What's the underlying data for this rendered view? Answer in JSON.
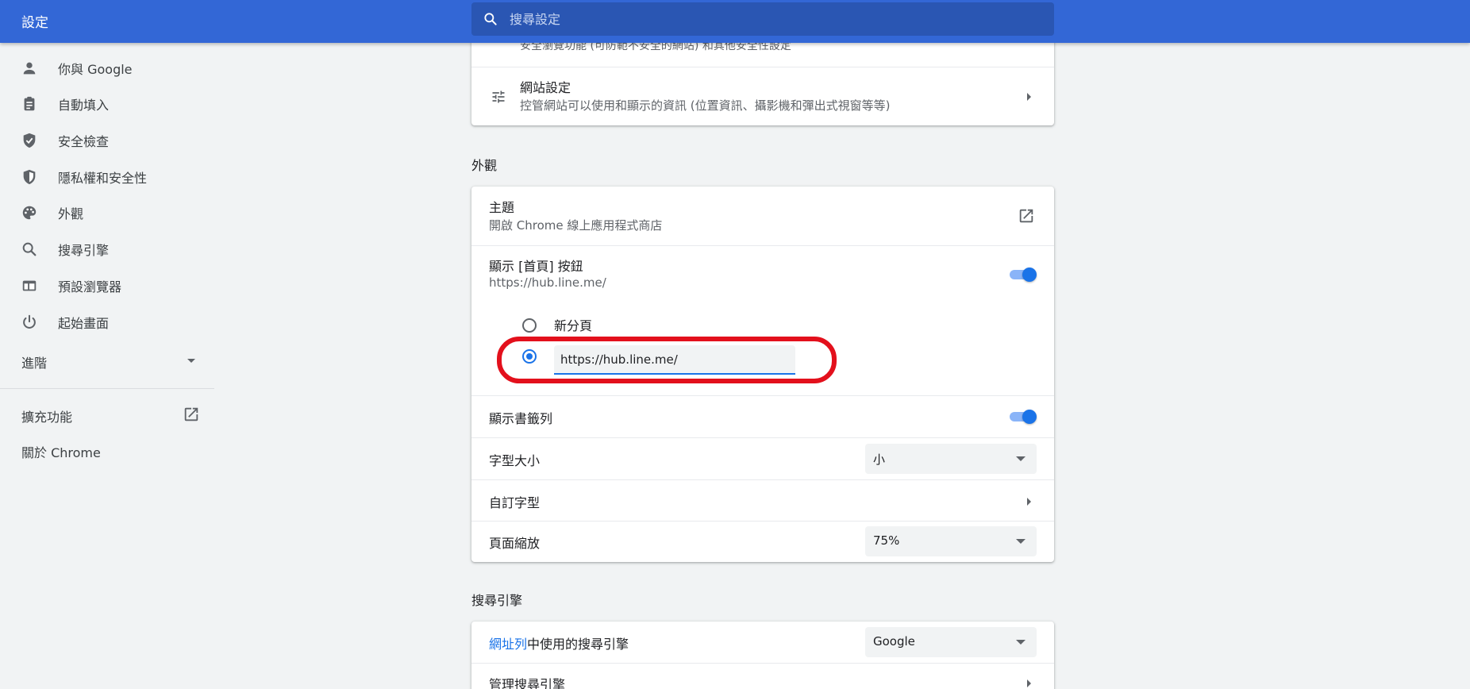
{
  "topbar": {
    "title": "設定",
    "search_placeholder": "搜尋設定"
  },
  "sidebar": {
    "items": [
      {
        "label": "你與 Google",
        "icon": "person-icon"
      },
      {
        "label": "自動填入",
        "icon": "clipboard-icon"
      },
      {
        "label": "安全檢查",
        "icon": "shield-check-icon"
      },
      {
        "label": "隱私權和安全性",
        "icon": "shield-icon"
      },
      {
        "label": "外觀",
        "icon": "palette-icon"
      },
      {
        "label": "搜尋引擎",
        "icon": "search-icon"
      },
      {
        "label": "預設瀏覽器",
        "icon": "browser-icon"
      },
      {
        "label": "起始畫面",
        "icon": "power-icon"
      }
    ],
    "advanced_label": "進階",
    "extensions_label": "擴充功能",
    "about_label": "關於 Chrome"
  },
  "privacy_card": {
    "partial_text": "安全瀏覽功能 (可防範不安全的網站) 和其他安全性設定",
    "site_settings_title": "網站設定",
    "site_settings_sub": "控管網站可以使用和顯示的資訊 (位置資訊、攝影機和彈出式視窗等等)"
  },
  "appearance": {
    "section_title": "外觀",
    "theme_title": "主題",
    "theme_sub": "開啟 Chrome 線上應用程式商店",
    "home_button_title": "顯示 [首頁] 按鈕",
    "home_button_sub": "https://hub.line.me/",
    "home_button_enabled": true,
    "radio_new_tab_label": "新分頁",
    "custom_url_value": "https://hub.line.me/",
    "bookmarks_bar_title": "顯示書籤列",
    "bookmarks_bar_enabled": true,
    "font_size_title": "字型大小",
    "font_size_value": "小",
    "custom_fonts_title": "自訂字型",
    "page_zoom_title": "頁面縮放",
    "page_zoom_value": "75%"
  },
  "search_engine": {
    "section_title": "搜尋引擎",
    "address_bar_link": "網址列",
    "address_bar_rest": "中使用的搜尋引擎",
    "engine_value": "Google",
    "manage_title": "管理搜尋引擎"
  },
  "colors": {
    "header": "#3367d6",
    "accent": "#1a73e8",
    "highlight": "#e3101c"
  }
}
